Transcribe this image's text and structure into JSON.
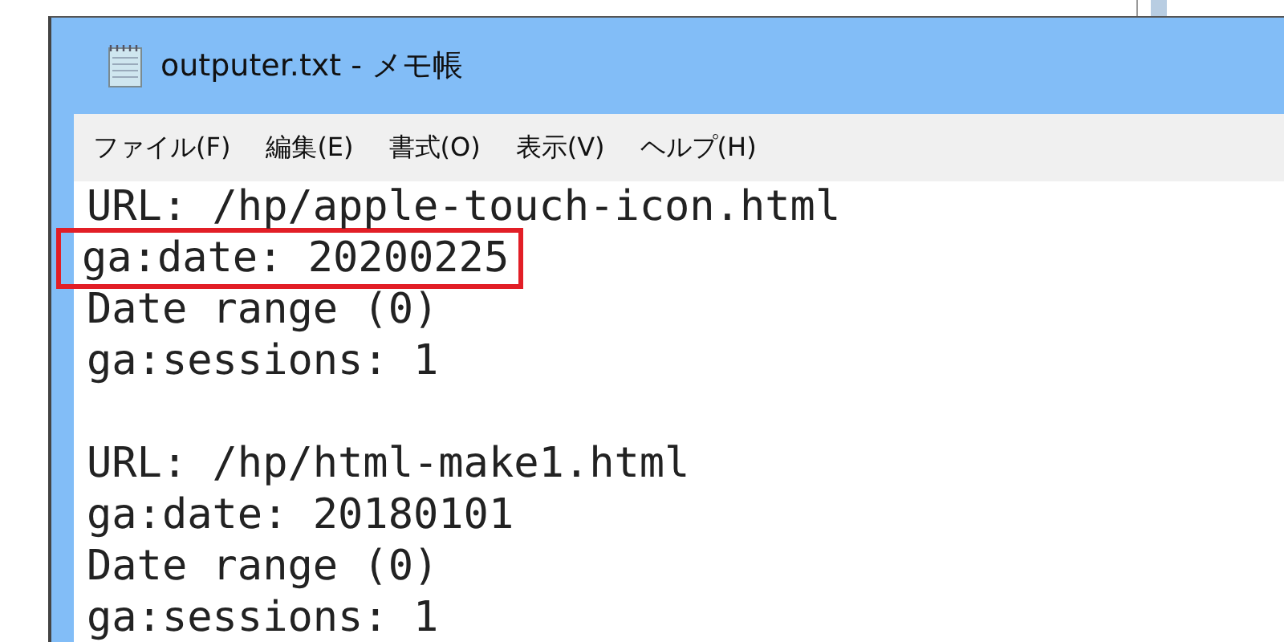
{
  "window": {
    "title": "outputer.txt - メモ帳"
  },
  "menu": [
    "ファイル(F)",
    "編集(E)",
    "書式(O)",
    "表示(V)",
    "ヘルプ(H)"
  ],
  "records": [
    {
      "lines": [
        {
          "text": "URL: /hp/apple-touch-icon.html",
          "highlighted": false
        },
        {
          "text": "ga:date: 20200225",
          "highlighted": true
        },
        {
          "text": "Date range (0)",
          "highlighted": false
        },
        {
          "text": "ga:sessions: 1",
          "highlighted": false
        }
      ]
    },
    {
      "lines": [
        {
          "text": "URL: /hp/html-make1.html",
          "highlighted": false
        },
        {
          "text": "ga:date: 20180101",
          "highlighted": false
        },
        {
          "text": "Date range (0)",
          "highlighted": false
        },
        {
          "text": "ga:sessions: 1",
          "highlighted": false
        }
      ]
    }
  ]
}
